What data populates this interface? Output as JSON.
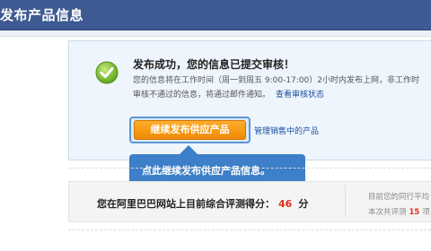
{
  "header": {
    "title": "发布产品信息"
  },
  "success": {
    "title": "发布成功，您的信息已提交审核！",
    "info_line1": "您的信息将在工作时间（周一到周五 9:00-17:00）2小时内发布上网，非工作时",
    "info_line2": "审核不通过的信息，将通过邮件通知。",
    "view_status_link": "查看审核状态"
  },
  "actions": {
    "continue_label": "继续发布供应产品",
    "manage_link": "管理销售中的产品"
  },
  "tooltip": {
    "text": "点此继续发布供应产品信息。"
  },
  "rating": {
    "prefix": "您在阿里巴巴网站上目前综合评测得分：",
    "score": "46",
    "unit": "分",
    "side_note1": "目前您的同行平均",
    "side_note2_prefix": "本次共评测",
    "side_note2_count": "15",
    "side_note2_suffix": "项"
  },
  "colors": {
    "header_bg": "#3e5a92",
    "panel_bg": "#eef5fc",
    "button": "#f08a00",
    "tooltip_bg": "#3d7fc8",
    "score": "#e0301e",
    "link": "#1a4fa0"
  },
  "icons": {
    "success": "check-circle-icon"
  }
}
